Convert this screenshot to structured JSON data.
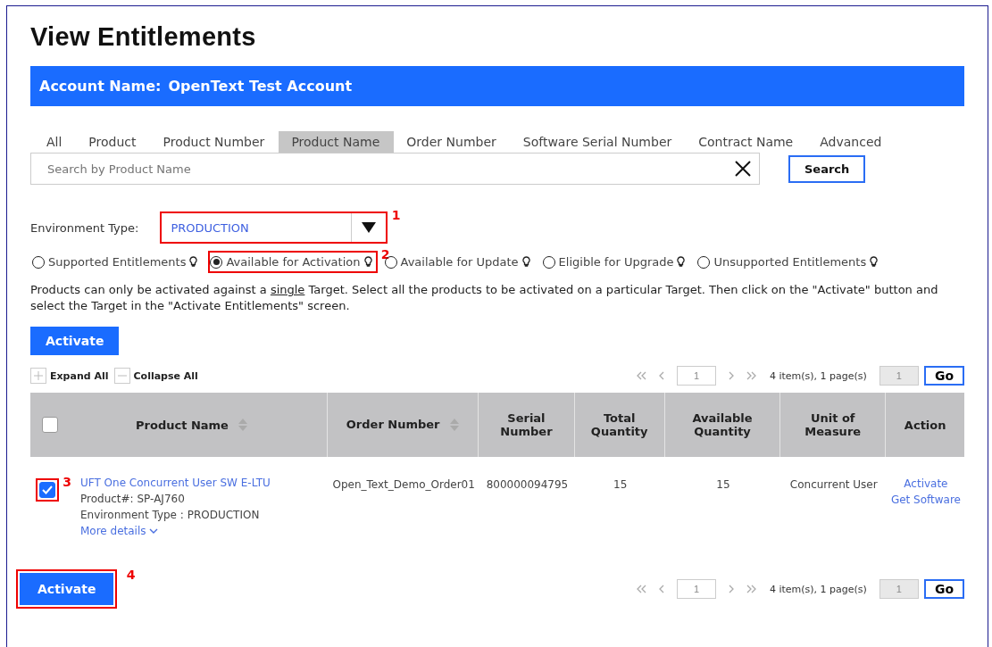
{
  "title": "View Entitlements",
  "account_bar": {
    "label": "Account Name:",
    "value": "OpenText Test Account"
  },
  "tabs": [
    {
      "label": "All",
      "selected": false
    },
    {
      "label": "Product",
      "selected": false
    },
    {
      "label": "Product Number",
      "selected": false
    },
    {
      "label": "Product Name",
      "selected": true
    },
    {
      "label": "Order Number",
      "selected": false
    },
    {
      "label": "Software Serial Number",
      "selected": false
    },
    {
      "label": "Contract Name",
      "selected": false
    },
    {
      "label": "Advanced",
      "selected": false
    }
  ],
  "search": {
    "placeholder": "Search by Product Name",
    "button": "Search"
  },
  "environment": {
    "label": "Environment Type:",
    "value": "PRODUCTION",
    "callout": "1"
  },
  "filters": [
    {
      "label": "Supported Entitlements",
      "selected": false
    },
    {
      "label": "Available for Activation",
      "selected": true,
      "callout": "2"
    },
    {
      "label": "Available for Update",
      "selected": false
    },
    {
      "label": "Eligible for Upgrade",
      "selected": false
    },
    {
      "label": "Unsupported Entitlements",
      "selected": false
    }
  ],
  "instructions": [
    "Products can only be activated against a ",
    "single",
    " Target.  Select all the products to be activated on a particular Target.  Then click on the \"Activate\" button and select the Target in the \"Activate Entitlements\" screen."
  ],
  "activate_top": {
    "label": "Activate"
  },
  "expand_all": "Expand All",
  "collapse_all": "Collapse All",
  "pager_top": {
    "page": "1",
    "summary": "4 item(s), 1 page(s)",
    "goto": "1",
    "go": "Go"
  },
  "table": {
    "select_all_checked": false,
    "columns": [
      {
        "label": "Product Name",
        "sortable": true
      },
      {
        "label": "Order Number",
        "sortable": true
      },
      {
        "label": "Serial Number",
        "sortable": false
      },
      {
        "label": "Total Quantity",
        "sortable": false
      },
      {
        "label": "Available Quantity",
        "sortable": false
      },
      {
        "label": "Unit of Measure",
        "sortable": false
      },
      {
        "label": "Action",
        "sortable": false
      }
    ],
    "rows": [
      {
        "checked": true,
        "callout": "3",
        "product": "UFT One Concurrent User SW E-LTU",
        "product_no_label": "Product#:",
        "product_no": "SP-AJ760",
        "env_label": "Environment Type :",
        "env": "PRODUCTION",
        "more": "More details",
        "order": "Open_Text_Demo_Order01",
        "serial": "800000094795",
        "total": "15",
        "available": "15",
        "unit": "Concurrent User",
        "actions": [
          "Activate",
          "Get Software"
        ]
      }
    ]
  },
  "activate_bottom": {
    "label": "Activate",
    "callout": "4"
  },
  "pager_bottom": {
    "page": "1",
    "summary": "4 item(s), 1 page(s)",
    "goto": "1",
    "go": "Go"
  }
}
